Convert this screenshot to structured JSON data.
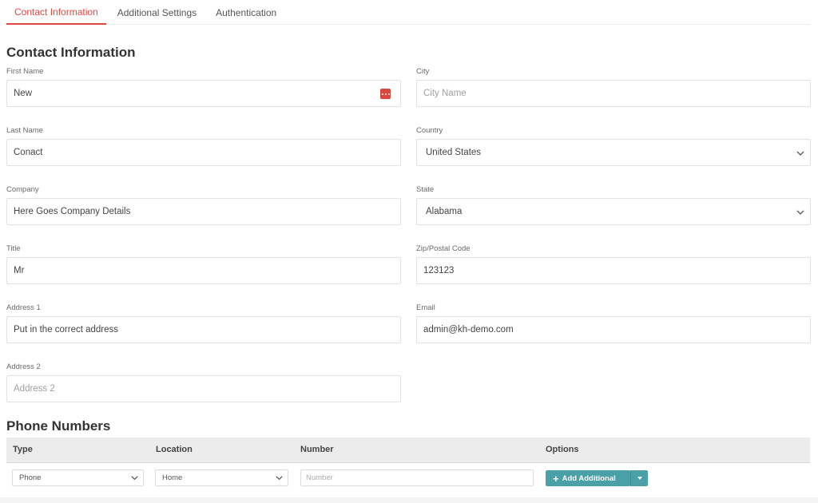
{
  "tabs": [
    {
      "label": "Contact Information"
    },
    {
      "label": "Additional Settings"
    },
    {
      "label": "Authentication"
    }
  ],
  "section_title": "Contact Information",
  "left_fields": [
    {
      "label": "First Name",
      "value": "New",
      "placeholder": ""
    },
    {
      "label": "Last Name",
      "value": "Conact",
      "placeholder": ""
    },
    {
      "label": "Company",
      "value": "Here Goes Company Details",
      "placeholder": ""
    },
    {
      "label": "Title",
      "value": "Mr",
      "placeholder": ""
    },
    {
      "label": "Address 1",
      "value": "Put in the correct address",
      "placeholder": ""
    },
    {
      "label": "Address 2",
      "value": "",
      "placeholder": "Address 2"
    }
  ],
  "right_fields": [
    {
      "label": "City",
      "value": "",
      "placeholder": "City Name"
    },
    {
      "label": "Country",
      "value": "United States",
      "placeholder": ""
    },
    {
      "label": "State",
      "value": "Alabama",
      "placeholder": ""
    },
    {
      "label": "Zip/Postal Code",
      "value": "123123",
      "placeholder": ""
    },
    {
      "label": "Email",
      "value": "admin@kh-demo.com",
      "placeholder": ""
    }
  ],
  "phone": {
    "title": "Phone Numbers",
    "columns": [
      "Type",
      "Location",
      "Number",
      "Options"
    ],
    "row": {
      "type": "Phone",
      "location": "Home",
      "number_placeholder": "Number"
    },
    "add_label": "Add Additional"
  },
  "colors": {
    "accent": "#e0473f",
    "button": "#4aa0a7"
  }
}
